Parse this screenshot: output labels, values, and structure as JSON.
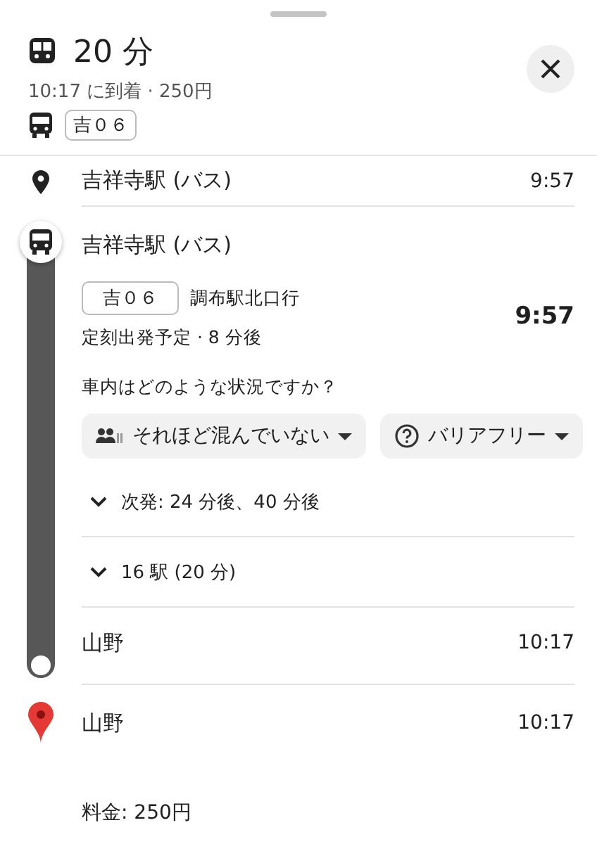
{
  "header": {
    "duration": "20 分",
    "summary": "10:17 に到着 · 250円",
    "route_badge": "吉０６"
  },
  "start": {
    "name": "吉祥寺駅 (バス)",
    "time": "9:57"
  },
  "segment": {
    "stop": "吉祥寺駅 (バス)",
    "badge": "吉０６",
    "headsign": "調布駅北口行",
    "status": "定刻出発予定 · 8 分後",
    "time": "9:57",
    "question": "車内はどのような状況ですか？",
    "chips": [
      {
        "kind": "crowd",
        "label": "それほど混んでいない"
      },
      {
        "kind": "accessibility",
        "label": "バリアフリー"
      }
    ],
    "expanders": [
      {
        "label": "次発: 24 分後、40 分後",
        "expanded": false
      },
      {
        "label": "16 駅 (20 分)",
        "expanded": false
      }
    ],
    "end": {
      "name": "山野",
      "time": "10:17"
    }
  },
  "destination": {
    "name": "山野",
    "time": "10:17"
  },
  "fare": "料金: 250円"
}
